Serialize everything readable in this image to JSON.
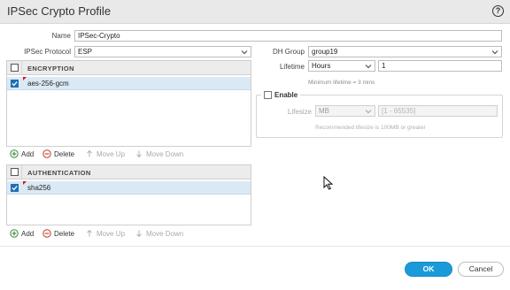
{
  "dialog": {
    "title": "IPSec Crypto Profile"
  },
  "form": {
    "name_label": "Name",
    "name_value": "IPSec-Crypto",
    "protocol_label": "IPSec Protocol",
    "protocol_value": "ESP",
    "dh_label": "DH Group",
    "dh_value": "group19",
    "lifetime_label": "Lifetime",
    "lifetime_unit": "Hours",
    "lifetime_value": "1",
    "lifetime_hint": "Minimum lifetime = 3 mins",
    "enable_label": "Enable",
    "lifesize_label": "Lifesize",
    "lifesize_unit": "MB",
    "lifesize_placeholder": "[1 - 65535]",
    "lifesize_hint": "Recommended lifesize is 100MB or greater"
  },
  "encryption": {
    "header": "ENCRYPTION",
    "rows": [
      "aes-256-gcm"
    ]
  },
  "authentication": {
    "header": "AUTHENTICATION",
    "rows": [
      "sha256"
    ]
  },
  "toolbar": {
    "add": "Add",
    "delete": "Delete",
    "move_up": "Move Up",
    "move_down": "Move Down"
  },
  "buttons": {
    "ok": "OK",
    "cancel": "Cancel"
  },
  "colors": {
    "accent": "#1a9ad8",
    "selected_row": "#dbe9f5",
    "checkbox": "#1f6fb6"
  }
}
